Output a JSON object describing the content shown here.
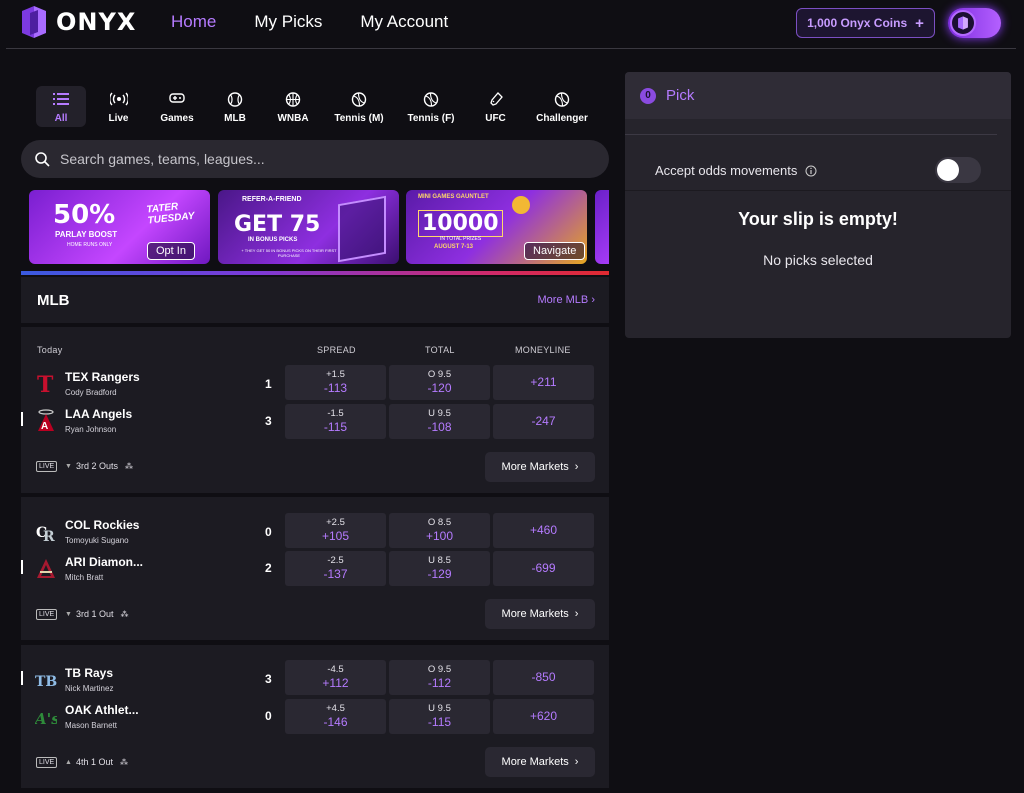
{
  "brand": {
    "name": "ONYX",
    "accent": "#b57bff"
  },
  "nav": [
    {
      "label": "Home",
      "active": true
    },
    {
      "label": "My Picks",
      "active": false
    },
    {
      "label": "My Account",
      "active": false
    }
  ],
  "coins": {
    "label": "1,000 Onyx Coins",
    "plus": "+"
  },
  "categories": [
    {
      "label": "All",
      "icon": "list-icon"
    },
    {
      "label": "Live",
      "icon": "broadcast-icon"
    },
    {
      "label": "Games",
      "icon": "gamepad-icon"
    },
    {
      "label": "MLB",
      "icon": "baseball-icon"
    },
    {
      "label": "WNBA",
      "icon": "basketball-icon"
    },
    {
      "label": "Tennis (M)",
      "icon": "tennis-ball-icon"
    },
    {
      "label": "Tennis (F)",
      "icon": "tennis-ball-icon"
    },
    {
      "label": "UFC",
      "icon": "glove-icon"
    },
    {
      "label": "Challenger",
      "icon": "tennis-ball-icon"
    }
  ],
  "search": {
    "placeholder": "Search games, teams, leagues..."
  },
  "banners": {
    "b1": {
      "big": "50%",
      "sub": "PARLAY BOOST",
      "small": "HOME RUNS ONLY",
      "side": "TATER TUESDAY",
      "button": "Opt In"
    },
    "b2": {
      "top": "REFER-A-FRIEND",
      "big": "GET 75",
      "sub": "IN BONUS PICKS",
      "small": "+ THEY GET 50 IN BONUS PICKS ON THEIR FIRST PURCHASE"
    },
    "b3": {
      "top": "MINI GAMES GAUNTLET",
      "big": "10000",
      "sub": "IN TOTAL PRIZES",
      "date": "AUGUST 7-13",
      "button": "Navigate"
    }
  },
  "section": {
    "title": "MLB",
    "more": "More MLB"
  },
  "columns": {
    "day": "Today",
    "spread": "SPREAD",
    "total": "TOTAL",
    "moneyline": "MONEYLINE"
  },
  "games": [
    {
      "teams": [
        {
          "name": "TEX Rangers",
          "pitcher": "Cody Bradford",
          "score": "1",
          "spread_line": "+1.5",
          "spread_odds": "-113",
          "total_line": "O 9.5",
          "total_odds": "-120",
          "moneyline": "+211"
        },
        {
          "name": "LAA Angels",
          "pitcher": "Ryan Johnson",
          "score": "3",
          "spread_line": "-1.5",
          "spread_odds": "-115",
          "total_line": "U 9.5",
          "total_odds": "-108",
          "moneyline": "-247"
        }
      ],
      "live": "LIVE",
      "inning": "3rd 2 Outs",
      "more": "More Markets"
    },
    {
      "teams": [
        {
          "name": "COL Rockies",
          "pitcher": "Tomoyuki Sugano",
          "score": "0",
          "spread_line": "+2.5",
          "spread_odds": "+105",
          "total_line": "O 8.5",
          "total_odds": "+100",
          "moneyline": "+460"
        },
        {
          "name": "ARI Diamon...",
          "pitcher": "Mitch Bratt",
          "score": "2",
          "spread_line": "-2.5",
          "spread_odds": "-137",
          "total_line": "U 8.5",
          "total_odds": "-129",
          "moneyline": "-699"
        }
      ],
      "live": "LIVE",
      "inning": "3rd 1 Out",
      "more": "More Markets"
    },
    {
      "teams": [
        {
          "name": "TB Rays",
          "pitcher": "Nick Martinez",
          "score": "3",
          "spread_line": "-4.5",
          "spread_odds": "+112",
          "total_line": "O 9.5",
          "total_odds": "-112",
          "moneyline": "-850"
        },
        {
          "name": "OAK Athlet...",
          "pitcher": "Mason Barnett",
          "score": "0",
          "spread_line": "+4.5",
          "spread_odds": "-146",
          "total_line": "U 9.5",
          "total_odds": "-115",
          "moneyline": "+620"
        }
      ],
      "live": "LIVE",
      "inning": "4th 1 Out",
      "more": "More Markets"
    }
  ],
  "slip": {
    "count": "0",
    "title": "Pick",
    "accept": "Accept odds movements",
    "empty": "Your slip is empty!",
    "no_picks": "No picks selected"
  }
}
